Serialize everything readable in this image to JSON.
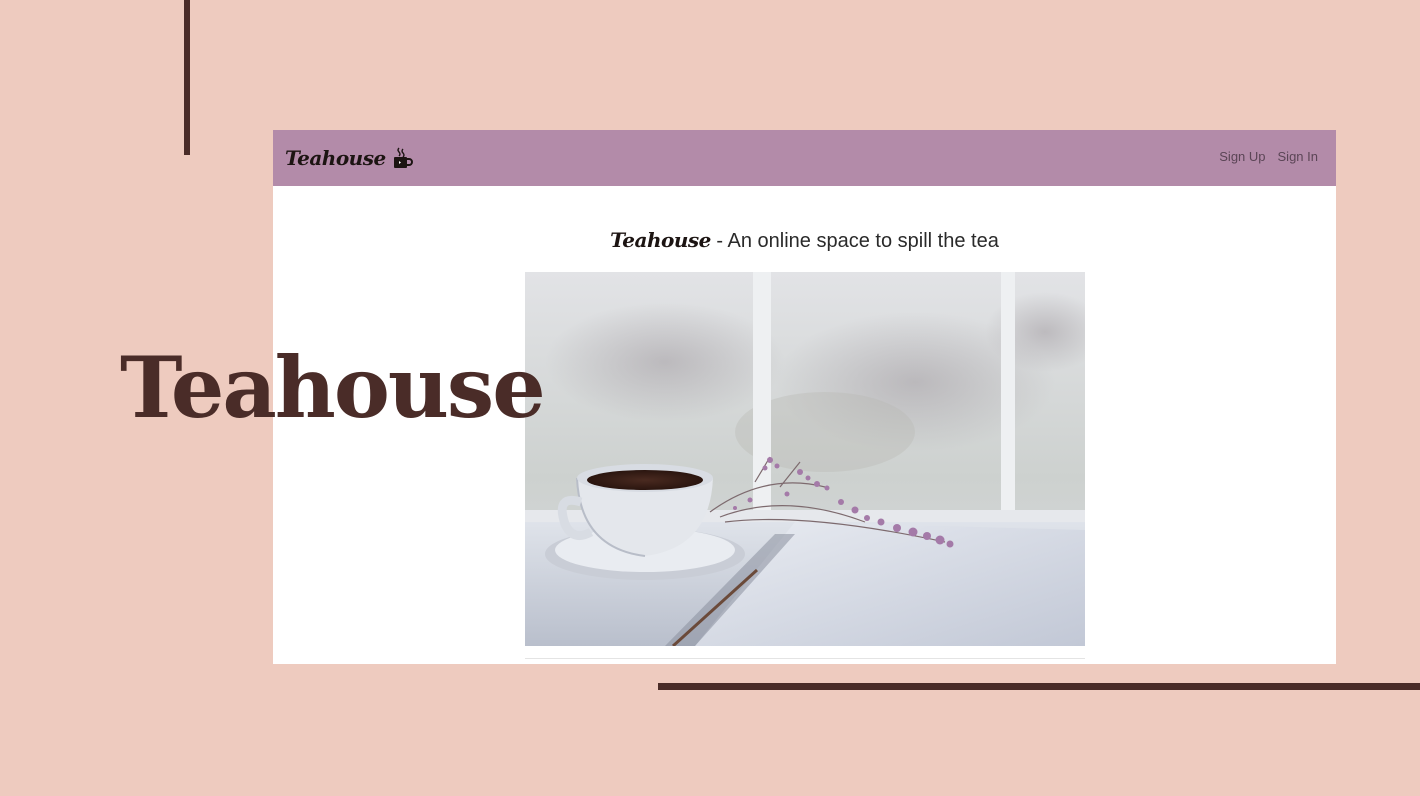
{
  "slide": {
    "title": "Teahouse",
    "colors": {
      "background": "#eecbbf",
      "accent": "#4a2c28"
    }
  },
  "app": {
    "brand": "Teahouse",
    "brand_icon": "coffee-cup-icon",
    "navbar_color": "#b38ba9",
    "nav": {
      "sign_up": "Sign Up",
      "sign_in": "Sign In"
    },
    "hero": {
      "tagline_brand": "Teahouse",
      "tagline_rest": " - An online space to spill the tea",
      "image": "teacup-with-lavender-on-open-book-photo"
    }
  }
}
